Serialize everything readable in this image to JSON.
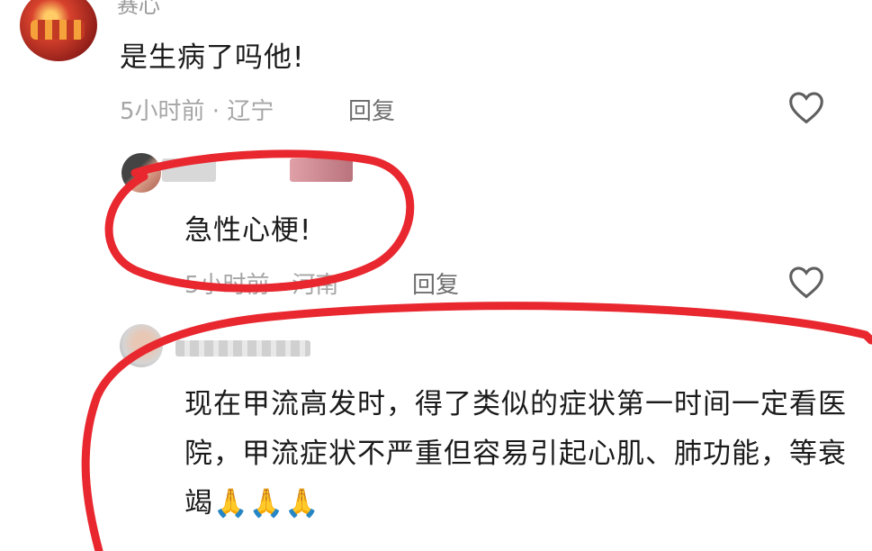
{
  "comments": [
    {
      "username": "赛心",
      "text": "是生病了吗他!",
      "time": "5小时前",
      "location": "辽宁",
      "reply_label": "回复"
    },
    {
      "text": "急性心梗!",
      "time": "5小时前",
      "location": "河南",
      "reply_label": "回复"
    },
    {
      "text": "现在甲流高发时，得了类似的症状第一时间一定看医院，甲流症状不严重但容易引起心肌、肺功能，等衰竭🙏🙏🙏"
    }
  ],
  "icons": {
    "like": "heart-outline-icon"
  },
  "colors": {
    "annotation_ink": "#e8272f",
    "meta_text": "#a6a6a6"
  }
}
